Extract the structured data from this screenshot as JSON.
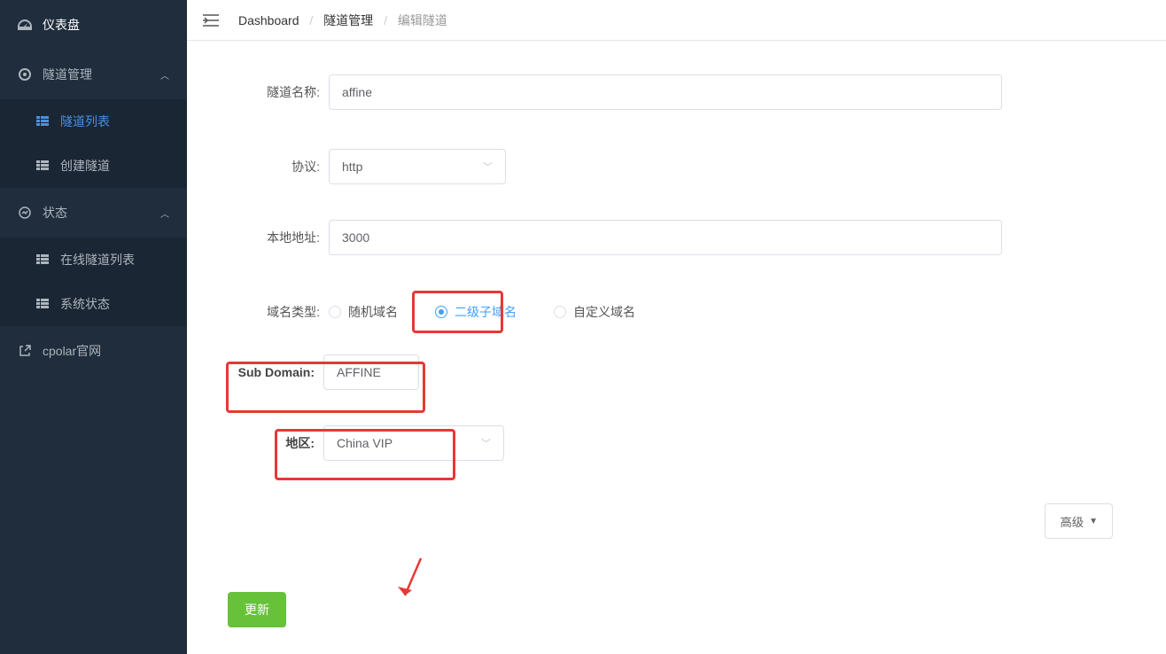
{
  "sidebar": {
    "items": [
      {
        "label": "仪表盘",
        "icon": "dashboard-icon"
      },
      {
        "label": "隧道管理",
        "icon": "tunnel-icon",
        "expandable": true
      },
      {
        "label": "隧道列表",
        "icon": "grid-icon",
        "sub": true,
        "active": true
      },
      {
        "label": "创建隧道",
        "icon": "grid-icon",
        "sub": true
      },
      {
        "label": "状态",
        "icon": "status-icon",
        "expandable": true
      },
      {
        "label": "在线隧道列表",
        "icon": "grid-icon",
        "sub": true
      },
      {
        "label": "系统状态",
        "icon": "grid-icon",
        "sub": true
      },
      {
        "label": "cpolar官网",
        "icon": "external-link-icon"
      }
    ]
  },
  "breadcrumb": {
    "items": [
      "Dashboard",
      "隧道管理",
      "编辑隧道"
    ]
  },
  "form": {
    "tunnel_name_label": "隧道名称:",
    "tunnel_name_value": "affine",
    "protocol_label": "协议:",
    "protocol_value": "http",
    "local_addr_label": "本地地址:",
    "local_addr_value": "3000",
    "domain_type_label": "域名类型:",
    "domain_type_options": [
      {
        "label": "随机域名",
        "selected": false
      },
      {
        "label": "二级子域名",
        "selected": true
      },
      {
        "label": "自定义域名",
        "selected": false
      }
    ],
    "subdomain_label": "Sub Domain:",
    "subdomain_value": "AFFINE",
    "region_label": "地区:",
    "region_value": "China VIP",
    "advanced_label": "高级",
    "update_label": "更新"
  }
}
